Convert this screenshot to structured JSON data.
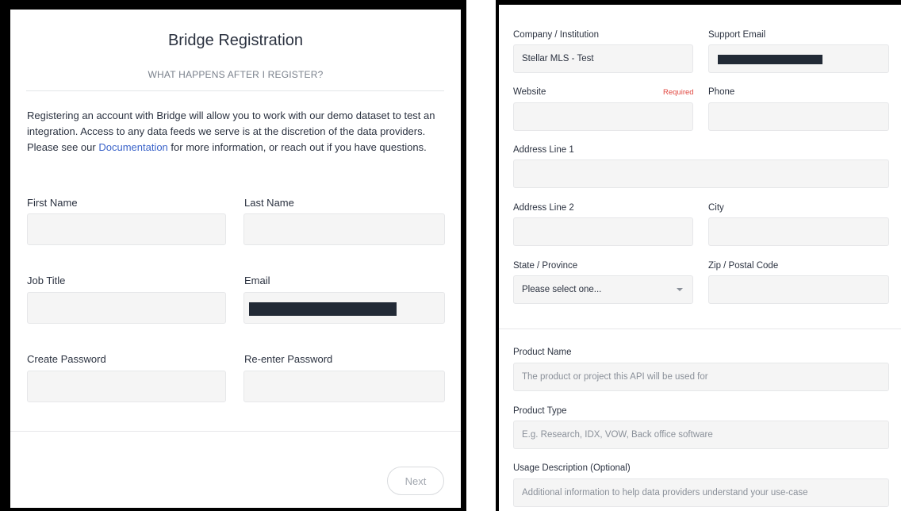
{
  "left": {
    "title": "Bridge Registration",
    "subtitle": "WHAT HAPPENS AFTER I REGISTER?",
    "intro_before": "Registering an account with Bridge will allow you to work with our demo dataset to test an integration. Access to any data feeds we serve is at the discretion of the data providers. Please see our ",
    "intro_link": "Documentation",
    "intro_after": " for more information, or reach out if you have questions.",
    "fields": {
      "first_name": "First Name",
      "last_name": "Last Name",
      "job_title": "Job Title",
      "email": "Email",
      "create_password": "Create Password",
      "reenter_password": "Re-enter Password"
    },
    "next_label": "Next"
  },
  "right": {
    "company_label": "Company / Institution",
    "company_value": "Stellar MLS - Test",
    "support_email_label": "Support Email",
    "website_label": "Website",
    "required_label": "Required",
    "phone_label": "Phone",
    "address1_label": "Address Line 1",
    "address2_label": "Address Line 2",
    "city_label": "City",
    "state_label": "State / Province",
    "state_value": "Please select one...",
    "zip_label": "Zip / Postal Code",
    "product_name_label": "Product Name",
    "product_name_placeholder": "The product or project this API will be used for",
    "product_type_label": "Product Type",
    "product_type_placeholder": "E.g. Research, IDX, VOW, Back office software",
    "usage_label": "Usage Description (Optional)",
    "usage_placeholder": "Additional information to help data providers understand your use-case"
  },
  "colors": {
    "link": "#3a63c9",
    "required": "#e0463f",
    "redaction": "#222a36",
    "field_bg": "#f5f5f5"
  }
}
